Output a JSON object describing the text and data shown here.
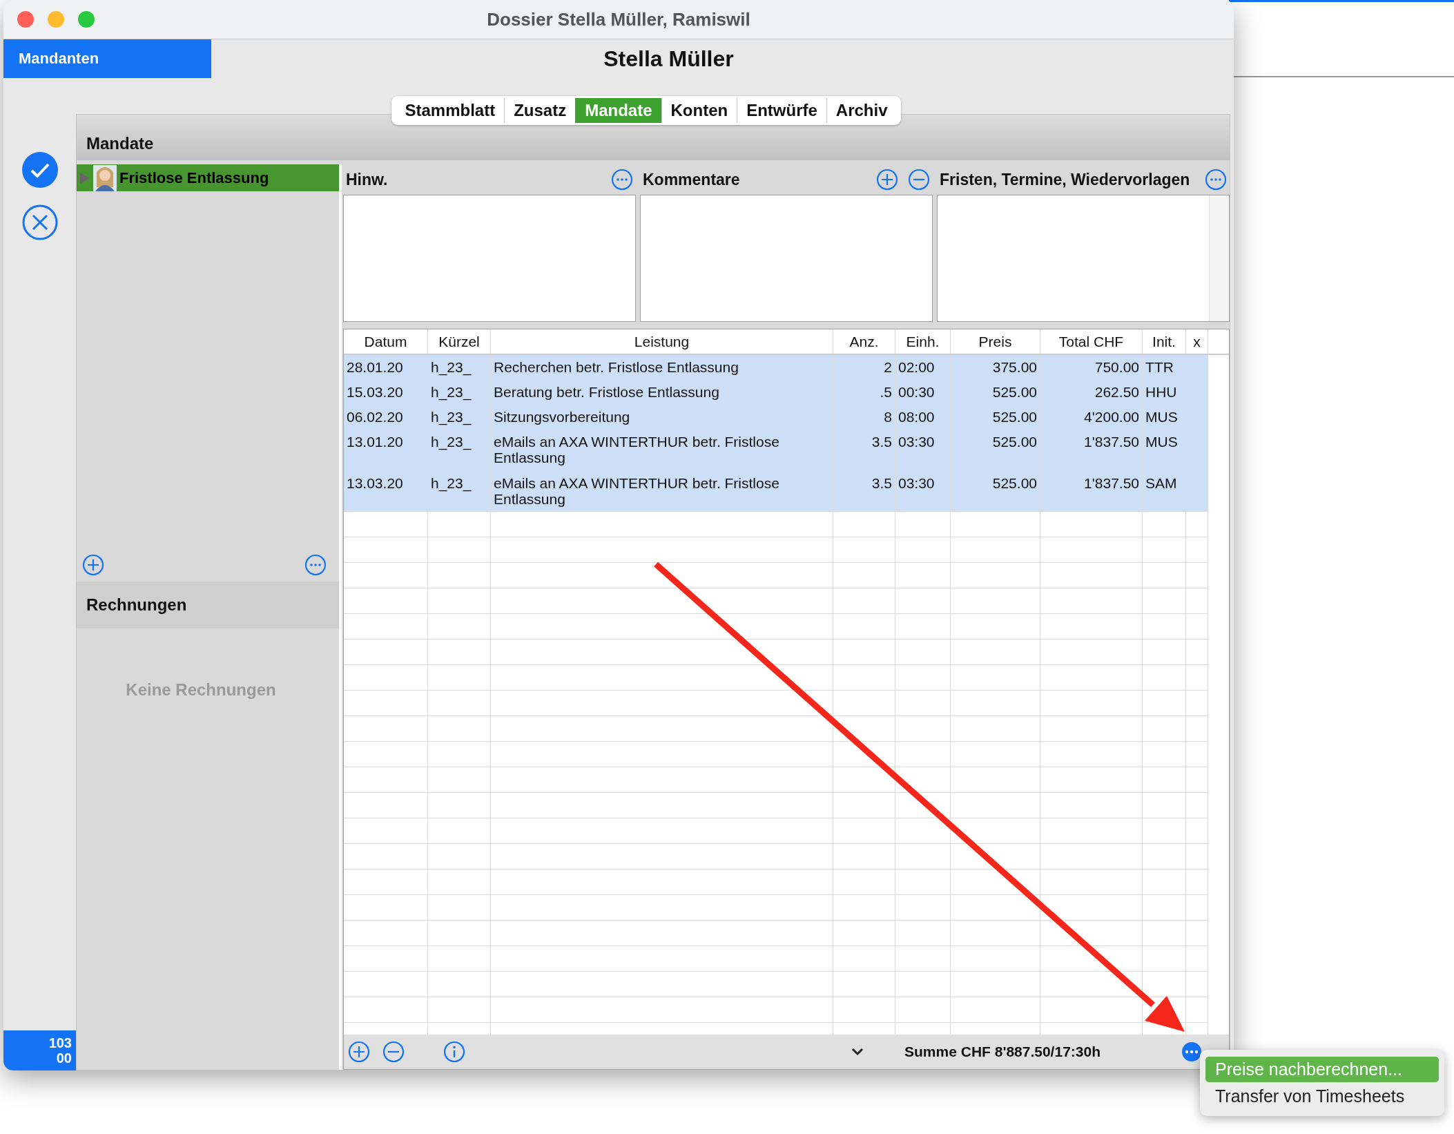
{
  "window": {
    "title": "Dossier Stella Müller, Ramiswil"
  },
  "sidebar": {
    "mandanten_button": "Mandanten",
    "badge_lines": [
      "103",
      "00"
    ]
  },
  "client_name": "Stella Müller",
  "tabs": [
    {
      "label": "Stammblatt",
      "selected": false
    },
    {
      "label": "Zusatz",
      "selected": false
    },
    {
      "label": "Mandate",
      "selected": true
    },
    {
      "label": "Konten",
      "selected": false
    },
    {
      "label": "Entwürfe",
      "selected": false
    },
    {
      "label": "Archiv",
      "selected": false
    }
  ],
  "mandates": {
    "title": "Mandate",
    "items": [
      {
        "label": "Fristlose Entlassung",
        "selected": true,
        "expanded": false
      }
    ]
  },
  "invoices": {
    "title": "Rechnungen",
    "empty_text": "Keine Rechnungen"
  },
  "notes_panels": [
    {
      "title": "Hinw."
    },
    {
      "title": "Kommentare"
    },
    {
      "title": "Fristen, Termine, Wiedervorlagen"
    }
  ],
  "table": {
    "columns": [
      "Datum",
      "Kürzel",
      "Leistung",
      "Anz.",
      "Einh.",
      "Preis",
      "Total CHF",
      "Init.",
      "x"
    ],
    "rows": [
      {
        "selected": true,
        "cells": [
          "28.01.20",
          "h_23_",
          "Recherchen betr. Fristlose Entlassung",
          "2",
          "02:00",
          "375.00",
          "750.00",
          "TTR"
        ]
      },
      {
        "selected": true,
        "cells": [
          "15.03.20",
          "h_23_",
          "Beratung betr. Fristlose Entlassung",
          ".5",
          "00:30",
          "525.00",
          "262.50",
          "HHU"
        ]
      },
      {
        "selected": true,
        "cells": [
          "06.02.20",
          "h_23_",
          "Sitzungsvorbereitung",
          "8",
          "08:00",
          "525.00",
          "4'200.00",
          "MUS"
        ]
      },
      {
        "selected": true,
        "cells": [
          "13.01.20",
          "h_23_",
          "eMails an AXA WINTERTHUR betr. Fristlose Entlassung",
          "3.5",
          "03:30",
          "525.00",
          "1'837.50",
          "MUS"
        ]
      },
      {
        "selected": true,
        "cells": [
          "13.03.20",
          "h_23_",
          "eMails an AXA WINTERTHUR betr. Fristlose Entlassung",
          "3.5",
          "03:30",
          "525.00",
          "1'837.50",
          "SAM"
        ]
      }
    ]
  },
  "footer": {
    "sum": "Summe CHF 8'887.50/17:30h"
  },
  "popup_menu": {
    "items": [
      {
        "label": "Preise nachberechnen...",
        "selected": true
      },
      {
        "label": "Transfer von Timesheets",
        "selected": false
      }
    ]
  }
}
